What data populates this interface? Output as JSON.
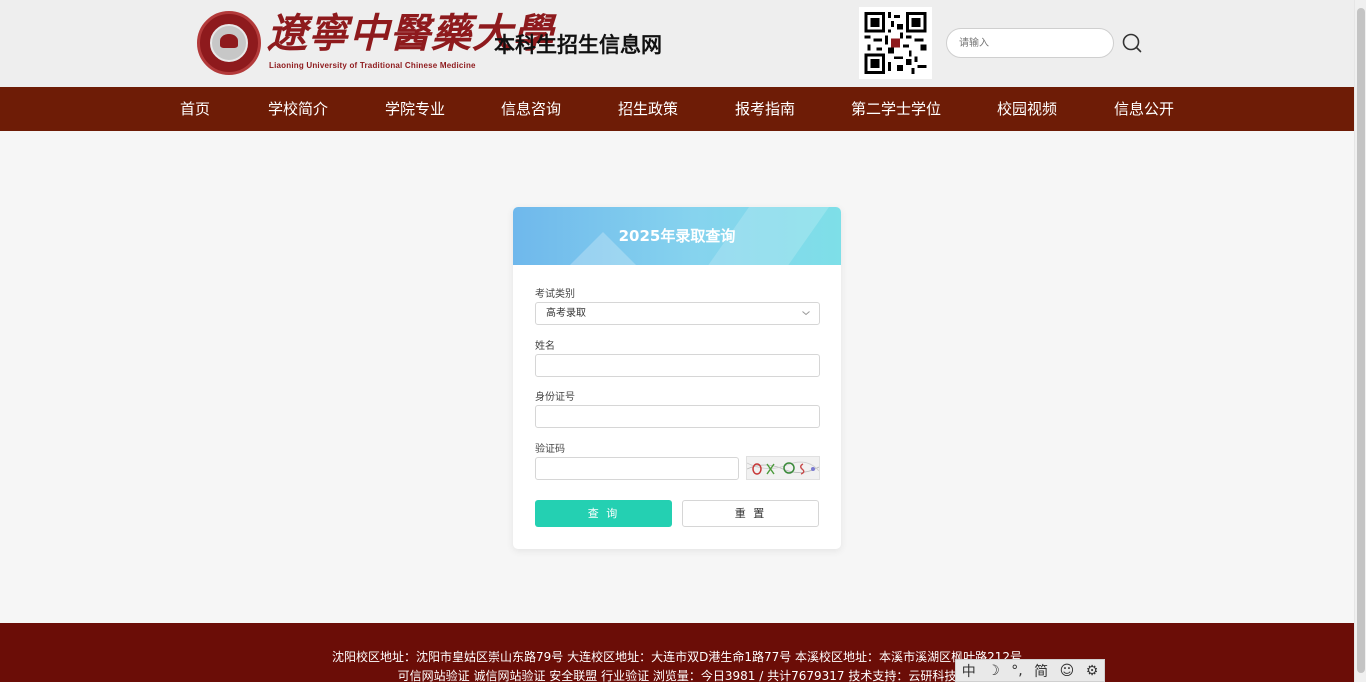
{
  "header": {
    "logo_cn": "遼寧中醫藥大學",
    "logo_en": "Liaoning University of Traditional Chinese Medicine",
    "site_title": "本科生招生信息网",
    "search_placeholder": "请输入"
  },
  "nav": {
    "items": [
      "首页",
      "学校简介",
      "学院专业",
      "信息咨询",
      "招生政策",
      "报考指南",
      "第二学士学位",
      "校园视频",
      "信息公开"
    ]
  },
  "form": {
    "title": "2025年录取查询",
    "exam_type_label": "考试类别",
    "exam_type_value": "高考录取",
    "name_label": "姓名",
    "id_label": "身份证号",
    "captcha_label": "验证码",
    "query_button": "查 询",
    "reset_button": "重 置"
  },
  "footer": {
    "line1": "沈阳校区地址：沈阳市皇姑区崇山东路79号    大连校区地址：大连市双D港生命1路77号    本溪校区地址：本溪市溪湖区枫叶路212号",
    "line2": "可信网站验证    诚信网站验证    安全联盟    行业验证    浏览量：今日3981 / 共计7679317    技术支持：云研科技"
  },
  "ime": [
    "中",
    "☽",
    "°,",
    "简",
    "☺",
    "⚙"
  ],
  "colors": {
    "nav_bg": "#6e1c06",
    "footer_bg": "#6b0d07",
    "brand_red": "#8e1a1d",
    "query_button": "#24d0b2"
  }
}
